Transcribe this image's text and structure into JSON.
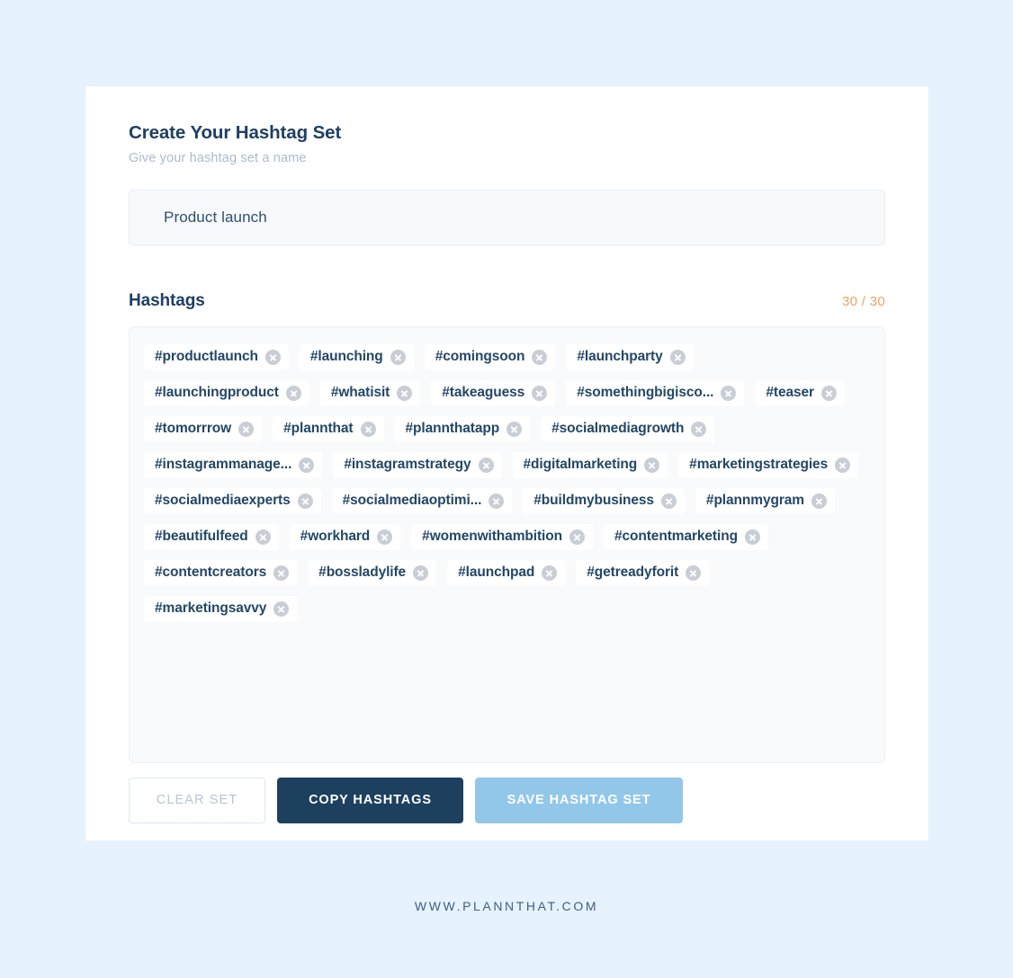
{
  "header": {
    "title": "Create Your Hashtag Set",
    "subtitle": "Give your hashtag set a name"
  },
  "name_input": {
    "value": "Product launch",
    "placeholder": "Give your hashtag set a name"
  },
  "hashtags_section": {
    "label": "Hashtags",
    "counter": "30 / 30",
    "counter_color": "#e9a367",
    "used": 30,
    "max": 30
  },
  "hashtags": [
    {
      "label": "#productlaunch",
      "remove_icon": "close-circle-icon"
    },
    {
      "label": "#launching",
      "remove_icon": "close-circle-icon"
    },
    {
      "label": "#comingsoon",
      "remove_icon": "close-circle-icon"
    },
    {
      "label": "#launchparty",
      "remove_icon": "close-circle-icon"
    },
    {
      "label": "#launchingproduct",
      "remove_icon": "close-circle-icon"
    },
    {
      "label": "#whatisit",
      "remove_icon": "close-circle-icon"
    },
    {
      "label": "#takeaguess",
      "remove_icon": "close-circle-icon"
    },
    {
      "label": "#somethingbigisco...",
      "remove_icon": "close-circle-icon"
    },
    {
      "label": "#teaser",
      "remove_icon": "close-circle-icon"
    },
    {
      "label": "#tomorrrow",
      "remove_icon": "close-circle-icon"
    },
    {
      "label": "#plannthat",
      "remove_icon": "close-circle-icon"
    },
    {
      "label": "#plannthatapp",
      "remove_icon": "close-circle-icon"
    },
    {
      "label": "#socialmediagrowth",
      "remove_icon": "close-circle-icon"
    },
    {
      "label": "#instagrammanage...",
      "remove_icon": "close-circle-icon"
    },
    {
      "label": "#instagramstrategy",
      "remove_icon": "close-circle-icon"
    },
    {
      "label": "#digitalmarketing",
      "remove_icon": "close-circle-icon"
    },
    {
      "label": "#marketingstrategies",
      "remove_icon": "close-circle-icon"
    },
    {
      "label": "#socialmediaexperts",
      "remove_icon": "close-circle-icon"
    },
    {
      "label": "#socialmediaoptimi...",
      "remove_icon": "close-circle-icon"
    },
    {
      "label": "#buildmybusiness",
      "remove_icon": "close-circle-icon"
    },
    {
      "label": "#plannmygram",
      "remove_icon": "close-circle-icon"
    },
    {
      "label": "#beautifulfeed",
      "remove_icon": "close-circle-icon"
    },
    {
      "label": "#workhard",
      "remove_icon": "close-circle-icon"
    },
    {
      "label": "#womenwithambition",
      "remove_icon": "close-circle-icon"
    },
    {
      "label": "#contentmarketing",
      "remove_icon": "close-circle-icon"
    },
    {
      "label": "#contentcreators",
      "remove_icon": "close-circle-icon"
    },
    {
      "label": "#bossladylife",
      "remove_icon": "close-circle-icon"
    },
    {
      "label": "#launchpad",
      "remove_icon": "close-circle-icon"
    },
    {
      "label": "#getreadyforit",
      "remove_icon": "close-circle-icon"
    },
    {
      "label": "#marketingsavvy",
      "remove_icon": "close-circle-icon"
    }
  ],
  "actions": {
    "clear_label": "CLEAR SET",
    "copy_label": "COPY HASHTAGS",
    "save_label": "SAVE HASHTAG SET"
  },
  "footer": {
    "text": "WWW.PLANNTHAT.COM"
  },
  "colors": {
    "page_background": "#e6f2fd",
    "card_background": "#ffffff",
    "heading": "#1e3f63",
    "subtitle": "#aebbcb",
    "tag_text": "#234766",
    "tag_background": "#ffffff",
    "tag_remove": "#c9ced6",
    "field_background": "#f7f9fc",
    "counter_accent": "#e9a367",
    "primary_dark": "#1d405f",
    "primary_light": "#93c7ea"
  }
}
